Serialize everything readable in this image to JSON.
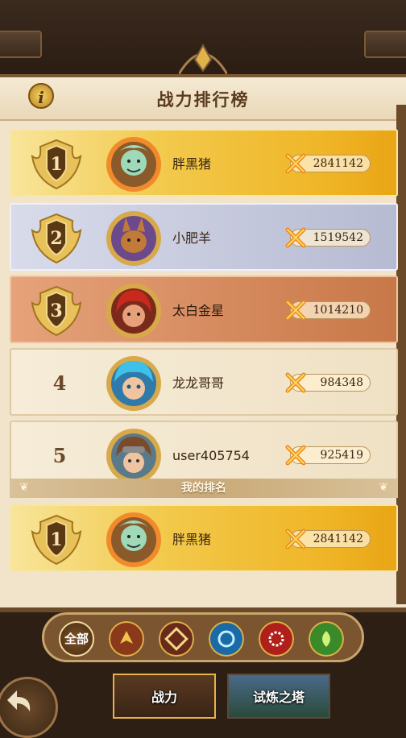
{
  "header": {
    "title": "战力排行榜",
    "info_icon": "i"
  },
  "ranking": [
    {
      "rank": "1",
      "name": "胖黑猪",
      "power": "2841142",
      "tier": "gold"
    },
    {
      "rank": "2",
      "name": "小肥羊",
      "power": "1519542",
      "tier": "silver"
    },
    {
      "rank": "3",
      "name": "太白金星",
      "power": "1014210",
      "tier": "bronze"
    },
    {
      "rank": "4",
      "name": "龙龙哥哥",
      "power": "984348",
      "tier": "plain"
    },
    {
      "rank": "5",
      "name": "user405754",
      "power": "925419",
      "tier": "plain"
    }
  ],
  "my_rank": {
    "label": "我的排名",
    "rank": "1",
    "name": "胖黑猪",
    "power": "2841142"
  },
  "filters": {
    "all_label": "全部",
    "icons": [
      "wings-icon",
      "knot-icon",
      "swirl-icon",
      "gear-sun-icon",
      "spiral-icon"
    ]
  },
  "tabs": [
    {
      "label": "战力",
      "active": true
    },
    {
      "label": "试炼之塔",
      "active": false
    }
  ],
  "colors": {
    "gold": "#f0b628",
    "silver": "#b7bbd2",
    "bronze": "#c87848",
    "panel": "#f1e4cb"
  }
}
